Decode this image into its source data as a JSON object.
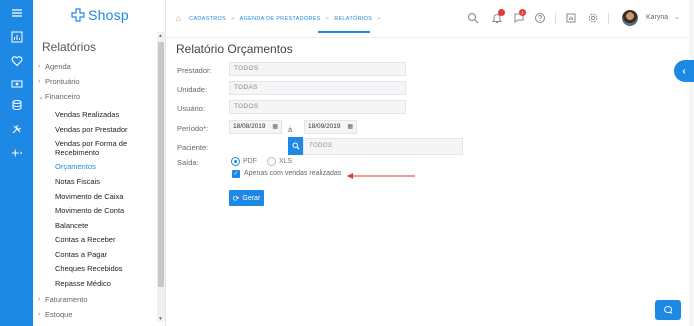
{
  "app": {
    "logo": "Shosp"
  },
  "rail_icons": [
    "menu-icon",
    "chart-icon",
    "heart-icon",
    "money-icon",
    "database-icon",
    "tools-icon",
    "plus-icon"
  ],
  "sidebar": {
    "title": "Relatórios",
    "groups": [
      {
        "label": "Agenda"
      },
      {
        "label": "Prontuário"
      },
      {
        "label": "Financeiro"
      }
    ],
    "sub_items": [
      "Vendas Realizadas",
      "Vendas por Prestador",
      "Vendas por Forma de Recebimento",
      "Orçamentos",
      "Notas Fiscais",
      "Movimento de Caixa",
      "Movimento de Conta",
      "Balancete",
      "Contas a Receber",
      "Contas a Pagar",
      "Cheques Recebidos",
      "Repasse Médico"
    ],
    "active_sub_item": "Orçamentos",
    "bottom_groups": [
      {
        "label": "Faturamento"
      },
      {
        "label": "Estoque"
      }
    ]
  },
  "breadcrumb": {
    "items": [
      "CADASTROS",
      "AGENDA DE PRESTADORES",
      "RELATÓRIOS"
    ],
    "sep": ">"
  },
  "topbar": {
    "notification_badge": "",
    "message_badge": "1",
    "user_name": "Karyna",
    "user_chevron": "⌄"
  },
  "form": {
    "title": "Relatório Orçamentos",
    "prestador_label": "Prestador:",
    "prestador_value": "TODOS",
    "unidade_label": "Unidade:",
    "unidade_value": "TODAS",
    "usuario_label": "Usuário:",
    "usuario_value": "TODOS",
    "periodo_label": "Período*:",
    "date_from": "18/08/2019",
    "between": "à",
    "date_to": "18/09/2019",
    "paciente_label": "Paciente:",
    "paciente_value": "TODOS",
    "saida_label": "Saída:",
    "output_options": [
      "PDF",
      "XLS"
    ],
    "selected_output": "PDF",
    "only_realized_label": "Apenas com vendas realizadas",
    "only_realized_checked": true,
    "generate_label": "Gerar"
  },
  "colors": {
    "primary": "#1e88e5",
    "annotation_arrow": "#e53935",
    "badge": "#e53935"
  }
}
